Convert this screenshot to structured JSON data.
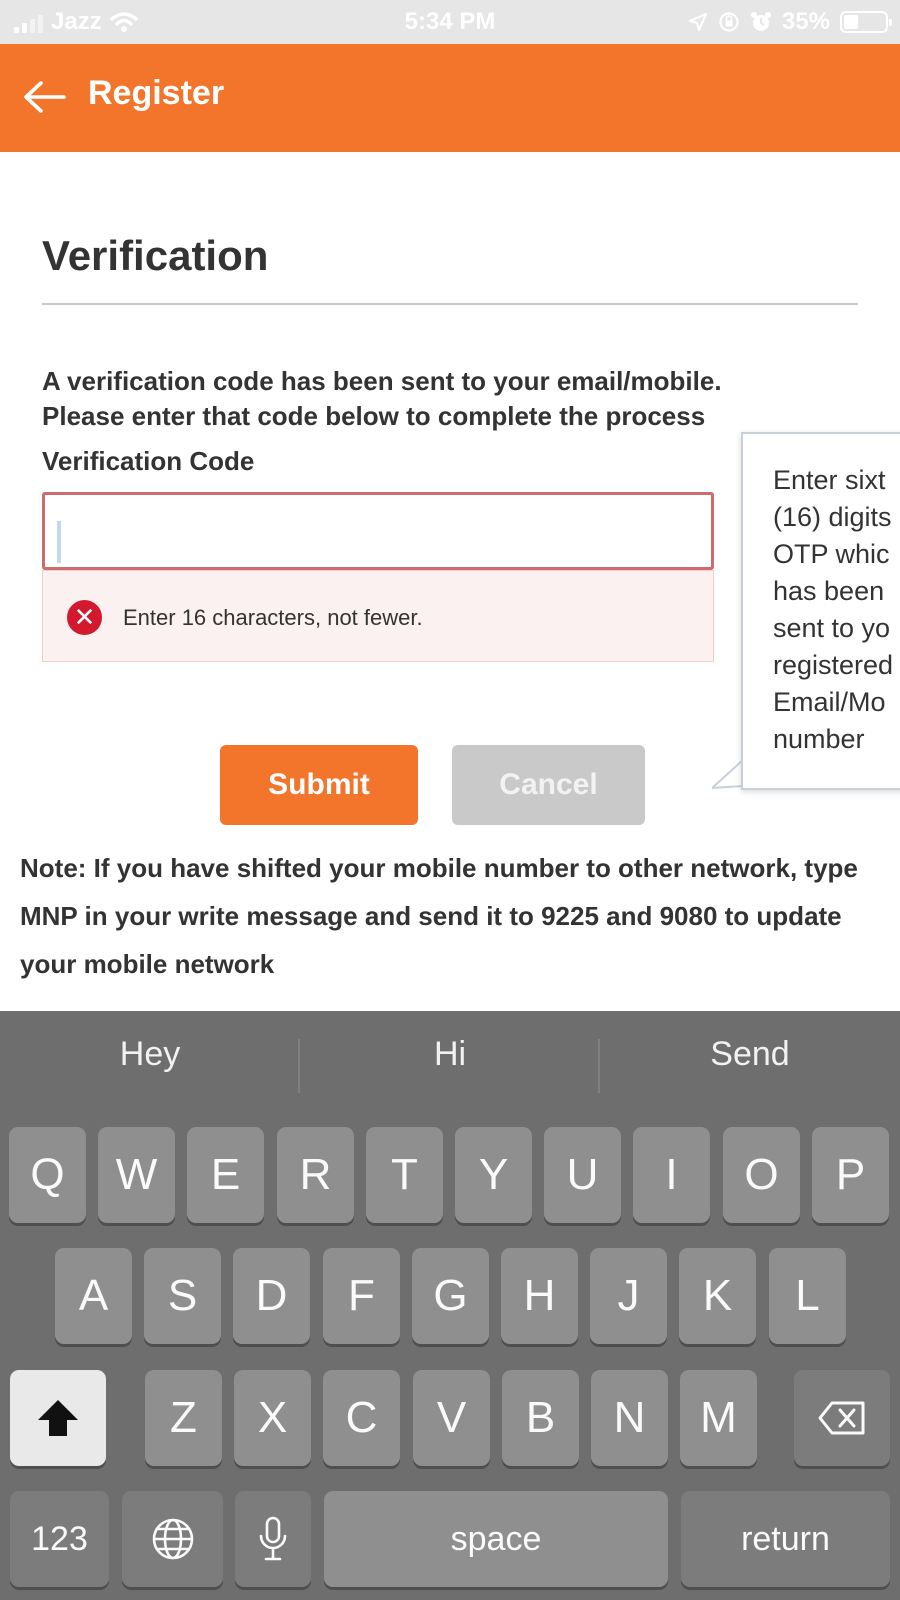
{
  "status_bar": {
    "carrier": "Jazz",
    "time": "5:34 PM",
    "battery": "35%",
    "battery_level": 0.35
  },
  "header": {
    "back_icon": "arrow-left-icon",
    "title": "Register"
  },
  "page": {
    "title": "Verification",
    "instructions_line1": "A verification code has been sent to your email/mobile.",
    "instructions_line2": "Please enter that code below to complete the process",
    "field_label": "Verification Code",
    "input_value": "",
    "error_icon": "error-x-icon",
    "error_text": "Enter 16 characters, not fewer.",
    "tooltip_text": "Enter sixt\n(16) digits\nOTP whic\nhas been\nsent to yo\nregistered\nEmail/Mo\nnumber",
    "submit_label": "Submit",
    "cancel_label": "Cancel",
    "note": "Note: If you have shifted your mobile number to other network, type MNP in your write message and send it to 9225 and 9080 to update your mobile network"
  },
  "colors": {
    "accent": "#f3752b",
    "error": "#d2192e",
    "keyboard_bg": "#6e6e6e"
  },
  "keyboard": {
    "suggestions": [
      "Hey",
      "Hi",
      "Send"
    ],
    "row1": [
      "Q",
      "W",
      "E",
      "R",
      "T",
      "Y",
      "U",
      "I",
      "O",
      "P"
    ],
    "row2": [
      "A",
      "S",
      "D",
      "F",
      "G",
      "H",
      "J",
      "K",
      "L"
    ],
    "row3": [
      "Z",
      "X",
      "C",
      "V",
      "B",
      "N",
      "M"
    ],
    "shift_icon": "shift-arrow-icon",
    "backspace_icon": "backspace-icon",
    "numbers_label": "123",
    "globe_icon": "globe-icon",
    "mic_icon": "microphone-icon",
    "space_label": "space",
    "return_label": "return"
  }
}
